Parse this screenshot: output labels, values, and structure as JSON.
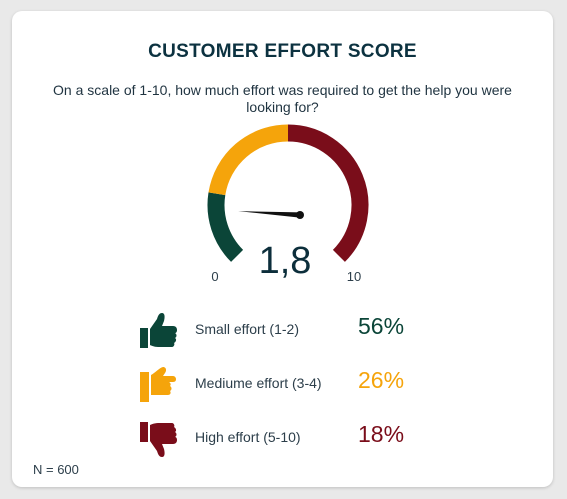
{
  "chart_data": {
    "type": "gauge",
    "title": "CUSTOMER EFFORT SCORE",
    "subtitle": "On a scale of 1-10, how much effort was required to get the help you were looking for?",
    "value": 1.8,
    "value_label": "1,8",
    "min": 0,
    "max": 10,
    "min_label": "0",
    "max_label": "10",
    "bands": [
      {
        "from": 0,
        "to": 2,
        "color": "#0b4538"
      },
      {
        "from": 2,
        "to": 5,
        "color": "#f5a40b"
      },
      {
        "from": 5,
        "to": 10,
        "color": "#7a0d1a"
      }
    ],
    "categories": [
      {
        "label": "Small effort (1-2)",
        "percent": 56,
        "percent_label": "56%",
        "color": "#0b4538",
        "icon": "thumbs-up-icon"
      },
      {
        "label": "Mediume effort (3-4)",
        "percent": 26,
        "percent_label": "26%",
        "color": "#f5a40b",
        "icon": "thumbs-sideways-icon"
      },
      {
        "label": "High effort (5-10)",
        "percent": 18,
        "percent_label": "18%",
        "color": "#7a0d1a",
        "icon": "thumbs-down-icon"
      }
    ],
    "n_label": "N = 600"
  }
}
